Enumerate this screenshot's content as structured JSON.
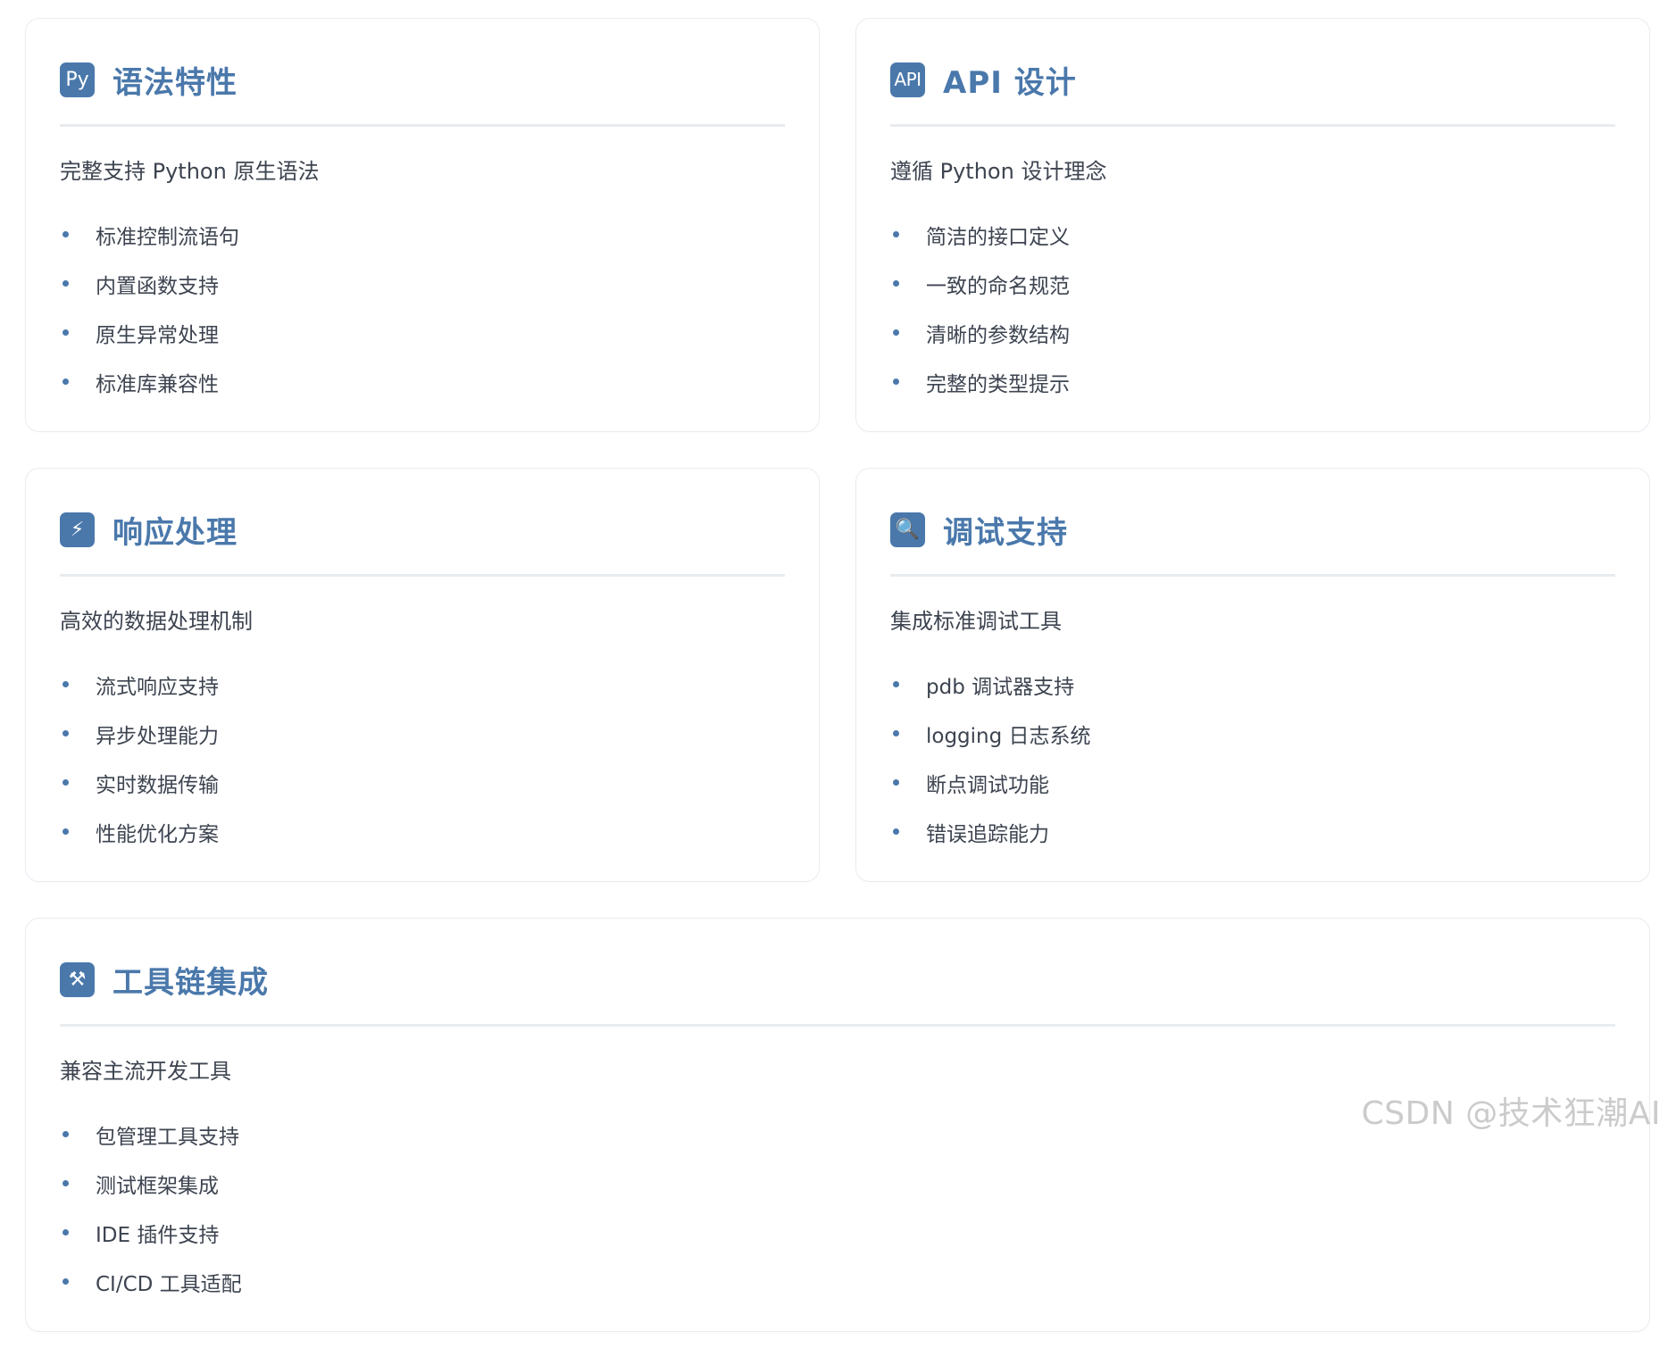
{
  "cards": [
    {
      "icon": "py-icon",
      "icon_text": "Py",
      "title": "语法特性",
      "subtitle": "完整支持 Python 原生语法",
      "items": [
        "标准控制流语句",
        "内置函数支持",
        "原生异常处理",
        "标准库兼容性"
      ]
    },
    {
      "icon": "api-icon",
      "icon_text": "API",
      "title": "API 设计",
      "subtitle": "遵循 Python 设计理念",
      "items": [
        "简洁的接口定义",
        "一致的命名规范",
        "清晰的参数结构",
        "完整的类型提示"
      ]
    },
    {
      "icon": "lightning-icon",
      "icon_text": "⚡",
      "title": "响应处理",
      "subtitle": "高效的数据处理机制",
      "items": [
        "流式响应支持",
        "异步处理能力",
        "实时数据传输",
        "性能优化方案"
      ]
    },
    {
      "icon": "magnifier-icon",
      "icon_text": "🔍",
      "title": "调试支持",
      "subtitle": "集成标准调试工具",
      "items": [
        "pdb 调试器支持",
        "logging 日志系统",
        "断点调试功能",
        "错误追踪能力"
      ]
    },
    {
      "icon": "tools-icon",
      "icon_text": "⚒",
      "title": "工具链集成",
      "subtitle": "兼容主流开发工具",
      "items": [
        "包管理工具支持",
        "测试框架集成",
        "IDE 插件支持",
        "CI/CD 工具适配"
      ]
    }
  ],
  "watermark": "CSDN @技术狂潮AI",
  "colors": {
    "accent": "#4a78ab",
    "text": "#3d4450",
    "divider": "#e9ecef",
    "border": "#e8ecf1"
  }
}
